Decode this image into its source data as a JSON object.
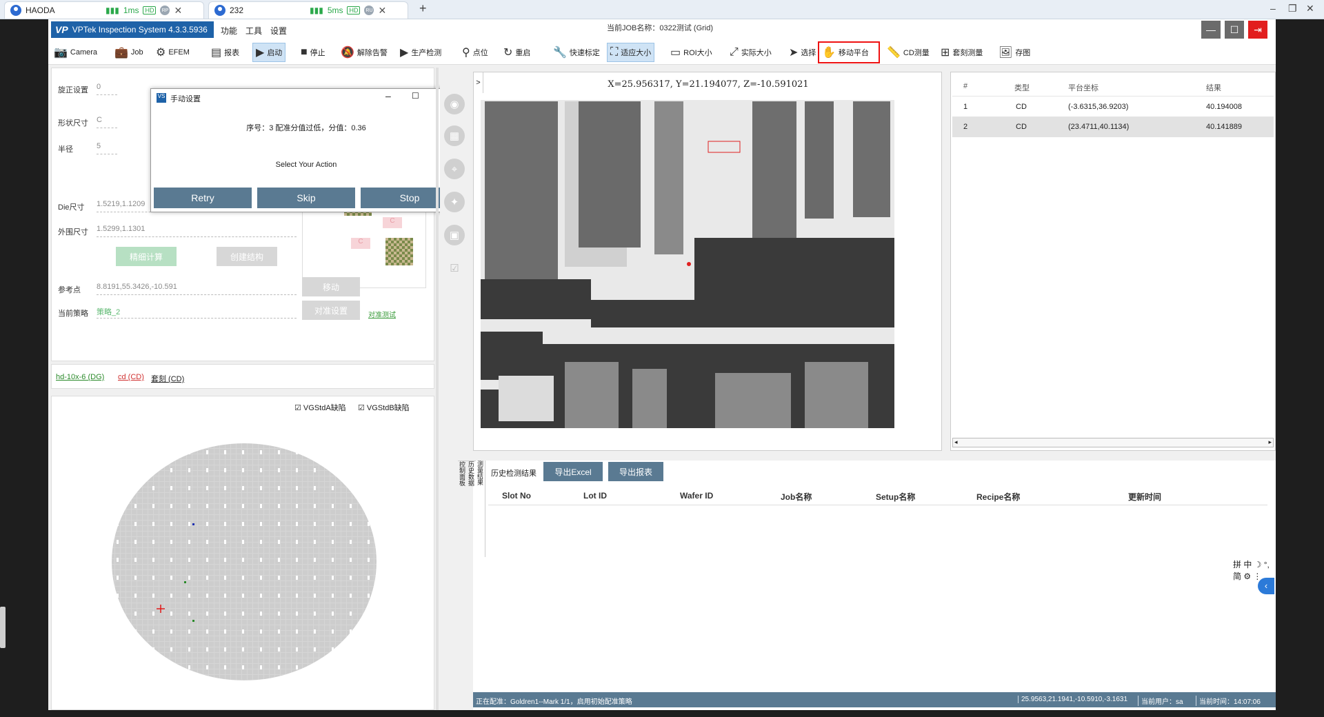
{
  "tabs": [
    {
      "name": "HAODA",
      "latency": "1ms",
      "hd": "HD",
      "badge": "RP"
    },
    {
      "name": "232",
      "latency": "5ms",
      "hd": "HD",
      "badge": "RU"
    }
  ],
  "app": {
    "title": "VPTek Inspection System 4.3.3.5936",
    "logo": "VP",
    "menus": [
      "功能",
      "工具",
      "设置"
    ],
    "job_name": "当前JOB名称：0322测试 (Grid)"
  },
  "toolbar": {
    "items": [
      "Camera",
      "Job",
      "EFEM",
      "报表",
      "启动",
      "停止",
      "解除告警",
      "生产检测",
      "点位",
      "重启",
      "快速标定",
      "适应大小",
      "ROI大小",
      "实际大小",
      "选择",
      "移动平台",
      "CD测量",
      "套刻测量",
      "存图"
    ]
  },
  "left": {
    "labels": {
      "rotate": "旋正设置",
      "shape": "形状尺寸",
      "radius": "半径",
      "die": "Die尺寸",
      "outer": "外围尺寸",
      "ref": "参考点",
      "strategy": "当前策略"
    },
    "partial_vals": {
      "rotate": "0",
      "shape": "C",
      "radius": "5"
    },
    "values": {
      "die": "1.5219,1.1209",
      "outer": "1.5299,1.1301",
      "ref": "8.8191,55.3426,-10.591",
      "strategy": "策略_2"
    },
    "buttons": {
      "calc": "精细计算",
      "create": "创建结构",
      "move": "移动",
      "align": "对准设置",
      "align_test": "对准测试"
    },
    "recipe_links": [
      "hd-10x-6 (DG)",
      "cd (CD)",
      "套刻 (CD)"
    ],
    "checkboxes": [
      "VGStdA缺陷",
      "VGStdB缺陷"
    ],
    "marker_letter": "C"
  },
  "dialog": {
    "title": "手动设置",
    "message": "序号：3 配准分值过低，分值：0.36",
    "prompt": "Select Your Action",
    "buttons": [
      "Retry",
      "Skip",
      "Stop"
    ]
  },
  "image": {
    "coords": "X=25.956317, Y=21.194077, Z=-10.591021",
    "collapse": ">"
  },
  "results": {
    "headers": [
      "#",
      "类型",
      "平台坐标",
      "结果"
    ],
    "rows": [
      {
        "n": "1",
        "type": "CD",
        "pos": "(-3.6315,36.9203)",
        "result": "40.194008"
      },
      {
        "n": "2",
        "type": "CD",
        "pos": "(23.4711,40.1134)",
        "result": "40.141889"
      }
    ]
  },
  "history": {
    "side_tabs": [
      "测量结果",
      "历史数据",
      "控制面板"
    ],
    "title": "历史检测结果",
    "export_excel": "导出Excel",
    "export_report": "导出报表",
    "headers": [
      "Slot No",
      "Lot ID",
      "Wafer ID",
      "Job名称",
      "Setup名称",
      "Recipe名称",
      "更新时间"
    ],
    "ime": "拼 中 ☽ °, 简 ⚙ ⋮"
  },
  "status": {
    "msg": "正在配准：Goldren1--Mark 1/1，启用初始配准策略",
    "coords": "25.9563,21.1941,-10.5910,-3.1631",
    "user": "当前用户：sa",
    "time": "当前时间：14:07:06"
  },
  "colors": {
    "accent": "#1e62a8",
    "button": "#5a7a92",
    "green_btn": "#b7e0c3",
    "highlight": "#e11111"
  }
}
